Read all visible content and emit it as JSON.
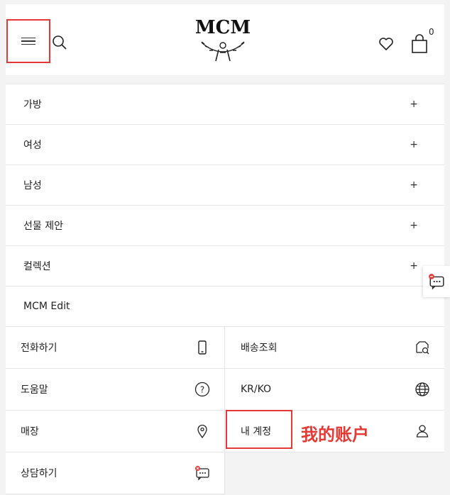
{
  "header": {
    "logo_text": "MCM",
    "cart_count": "0"
  },
  "menu": {
    "items": [
      {
        "label": "가방",
        "expand": "+"
      },
      {
        "label": "여성",
        "expand": "+"
      },
      {
        "label": "남성",
        "expand": "+"
      },
      {
        "label": "선물 제안",
        "expand": "+"
      },
      {
        "label": "컬렉션",
        "expand": "+"
      },
      {
        "label": "MCM Edit"
      }
    ]
  },
  "utility": {
    "call": "전화하기",
    "delivery": "배송조회",
    "help": "도움말",
    "locale": "KR/KO",
    "store": "매장",
    "account": "내 계정",
    "chat": "상담하기",
    "help_icon_glyph": "?"
  },
  "annotation": {
    "account_label": "我的账户",
    "color": "#e53935"
  },
  "icons": [
    "menu-icon",
    "search-icon",
    "heart-icon",
    "bag-icon",
    "phone-icon",
    "package-search-icon",
    "help-icon",
    "globe-icon",
    "location-pin-icon",
    "user-icon",
    "chat-icon"
  ]
}
